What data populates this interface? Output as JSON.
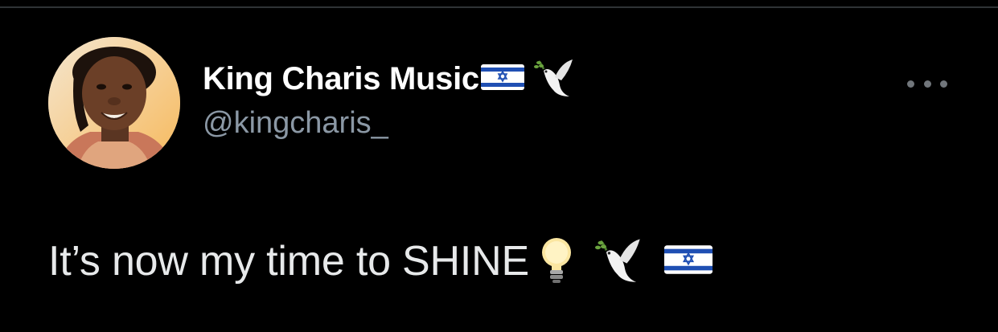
{
  "tweet": {
    "author": {
      "display_name": "King Charis Music",
      "handle": "@kingcharis_",
      "name_emojis": [
        "israel-flag-emoji",
        "dove-emoji"
      ]
    },
    "text": "It’s now my time to SHINE",
    "text_emojis": [
      "light-bulb-emoji",
      "dove-emoji",
      "israel-flag-emoji"
    ]
  },
  "colors": {
    "background": "#000000",
    "display_name": "#ffffff",
    "handle": "#8b98a5",
    "body_text": "#e7e9ea",
    "divider": "#2f3336"
  }
}
